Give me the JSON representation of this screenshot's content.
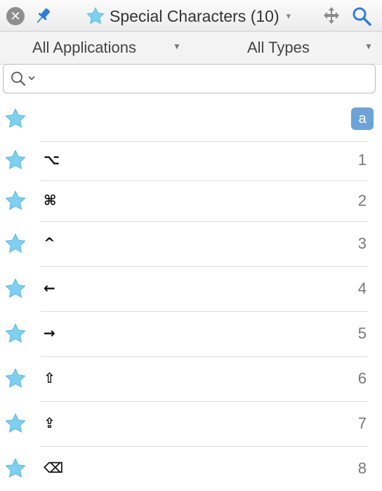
{
  "window": {
    "title": "Special Characters (10)",
    "title_caret": "▾",
    "close_glyph": "✕"
  },
  "filters": {
    "applications": "All Applications",
    "types": "All Types",
    "caret": "▼"
  },
  "search": {
    "value": "",
    "placeholder": ""
  },
  "items": [
    {
      "text": "",
      "key": "a",
      "selected": true
    },
    {
      "text": "⌥",
      "key": "1"
    },
    {
      "text": "⌘",
      "key": "2"
    },
    {
      "text": "^",
      "key": "3"
    },
    {
      "text": "←",
      "key": "4"
    },
    {
      "text": "→",
      "key": "5"
    },
    {
      "text": "⇧",
      "key": "6"
    },
    {
      "text": "⇪",
      "key": "7"
    },
    {
      "text": "⌫",
      "key": "8"
    }
  ],
  "colors": {
    "star": "#7fd0f0",
    "accent": "#2f7ed8",
    "selected_key_bg": "#6ea3d8"
  },
  "icons": [
    "close-icon",
    "pin-icon",
    "star-icon",
    "move-icon",
    "search-icon"
  ]
}
